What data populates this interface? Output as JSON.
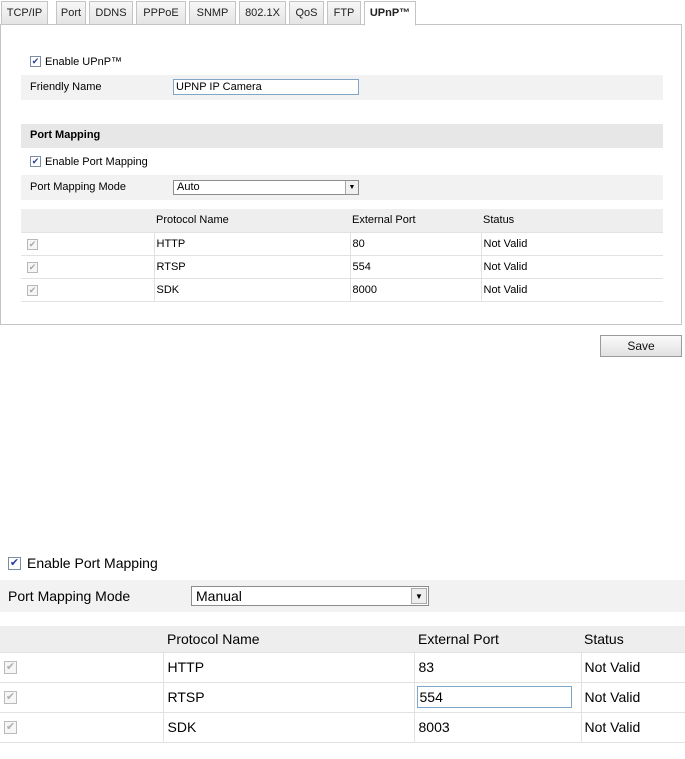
{
  "tabs": [
    {
      "label": "TCP/IP",
      "active": false
    },
    {
      "label": "Port",
      "active": false
    },
    {
      "label": "DDNS",
      "active": false
    },
    {
      "label": "PPPoE",
      "active": false
    },
    {
      "label": "SNMP",
      "active": false
    },
    {
      "label": "802.1X",
      "active": false
    },
    {
      "label": "QoS",
      "active": false
    },
    {
      "label": "FTP",
      "active": false
    },
    {
      "label": "UPnP™",
      "active": true
    }
  ],
  "upnp": {
    "enable_label": "Enable UPnP™",
    "enable_checked": true,
    "friendly_name_label": "Friendly Name",
    "friendly_name_value": "UPNP IP Camera"
  },
  "port_mapping": {
    "section_title": "Port Mapping",
    "enable_label": "Enable Port Mapping",
    "enable_checked": true,
    "mode_label": "Port Mapping Mode",
    "mode_value": "Auto",
    "columns": [
      "",
      "Protocol Name",
      "External Port",
      "Status"
    ],
    "rows": [
      {
        "protocol": "HTTP",
        "port": "80",
        "status": "Not Valid"
      },
      {
        "protocol": "RTSP",
        "port": "554",
        "status": "Not Valid"
      },
      {
        "protocol": "SDK",
        "port": "8000",
        "status": "Not Valid"
      }
    ]
  },
  "save_label": "Save",
  "manual_view": {
    "enable_label": "Enable Port Mapping",
    "mode_label": "Port Mapping Mode",
    "mode_value": "Manual",
    "columns": [
      "",
      "Protocol Name",
      "External Port",
      "Status"
    ],
    "rows": [
      {
        "protocol": "HTTP",
        "port": "83",
        "status": "Not Valid"
      },
      {
        "protocol": "RTSP",
        "port": "554",
        "status": "Not Valid"
      },
      {
        "protocol": "SDK",
        "port": "8003",
        "status": "Not Valid"
      }
    ]
  },
  "icons": {
    "checkbox": "checkmark-icon",
    "dropdown": "chevron-down-icon"
  },
  "colors": {
    "input_border": "#7fa5c8",
    "check": "#2b3f9a",
    "section_bg": "#e7e7e7"
  }
}
